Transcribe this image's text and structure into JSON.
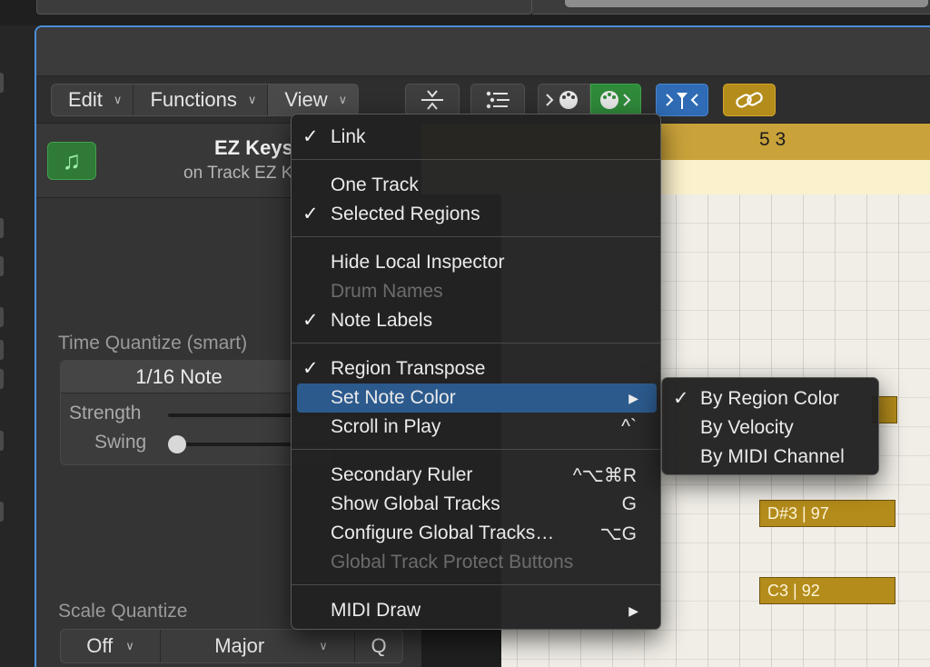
{
  "toolbar": {
    "menus": [
      {
        "label": "Edit"
      },
      {
        "label": "Functions"
      },
      {
        "label": "View"
      }
    ],
    "icons": {
      "collapse": "vertical-collapse-icon",
      "quantize": "quantize-icon",
      "midi_in": "palette-in-icon",
      "midi_out": "palette-out-icon",
      "catch": "catch-playhead-icon",
      "link": "link-icon"
    },
    "colors": {
      "midi_out": "#2f8a3a",
      "catch": "#2f6cb5",
      "link": "#b48c1b"
    }
  },
  "inspector": {
    "region_name": "EZ Keys",
    "region_sub": "on Track EZ K",
    "time_quantize_label": "Time Quantize (smart)",
    "time_quantize_value": "1/16 Note",
    "strength_label": "Strength",
    "swing_label": "Swing",
    "scale_quantize_label": "Scale Quantize",
    "scale_off": "Off",
    "scale_major": "Major",
    "scale_q": "Q"
  },
  "piano_roll": {
    "ruler_label": "5 3",
    "notes": [
      {
        "label": "D#3 | 97"
      },
      {
        "label": "C3 | 92"
      }
    ],
    "region_color": "#b48c1b"
  },
  "view_menu": {
    "items": [
      {
        "label": "Link",
        "checked": "✓"
      },
      {
        "label": "One Track",
        "checked": ""
      },
      {
        "label": "Selected Regions",
        "checked": "✓"
      },
      {
        "label": "Hide Local Inspector",
        "checked": ""
      },
      {
        "label": "Drum Names",
        "checked": ""
      },
      {
        "label": "Note Labels",
        "checked": "✓"
      },
      {
        "label": "Region Transpose",
        "checked": "✓"
      },
      {
        "label": "Set Note Color",
        "checked": ""
      },
      {
        "label": "Scroll in Play",
        "shortcut": "^`"
      },
      {
        "label": "Secondary Ruler",
        "shortcut": "^⌥⌘R"
      },
      {
        "label": "Show Global Tracks",
        "shortcut": "G"
      },
      {
        "label": "Configure Global Tracks…",
        "shortcut": "⌥G"
      },
      {
        "label": "Global Track Protect Buttons"
      },
      {
        "label": "MIDI Draw"
      }
    ]
  },
  "note_color_submenu": {
    "items": [
      {
        "label": "By Region Color",
        "checked": "✓"
      },
      {
        "label": "By Velocity",
        "checked": ""
      },
      {
        "label": "By MIDI Channel",
        "checked": ""
      }
    ]
  }
}
